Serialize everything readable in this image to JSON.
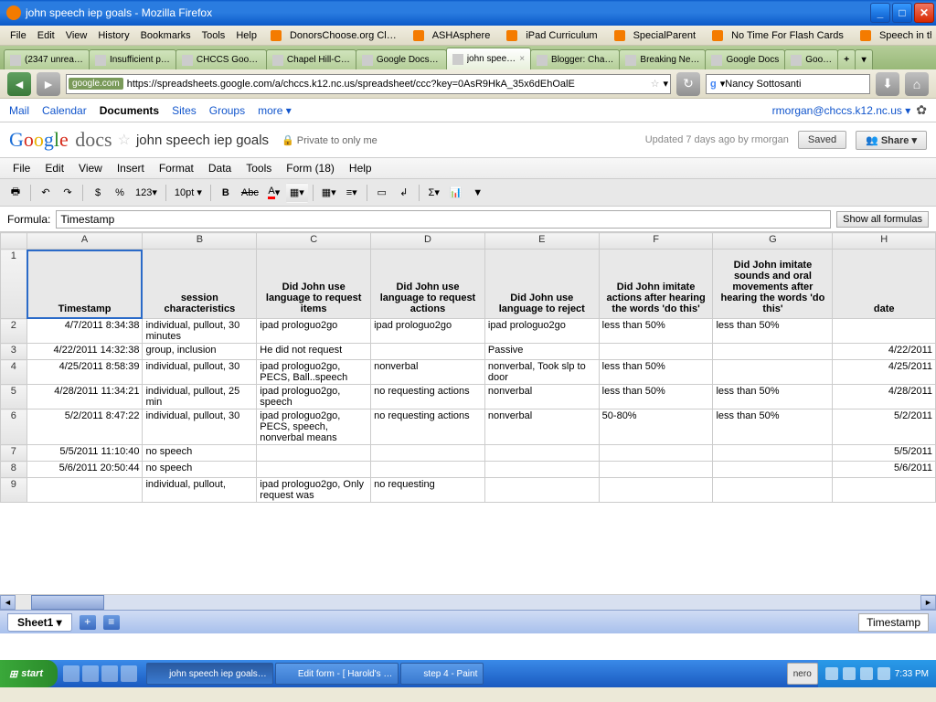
{
  "window": {
    "title": "john speech iep goals - Mozilla Firefox"
  },
  "firefoxMenu": [
    "File",
    "Edit",
    "View",
    "History",
    "Bookmarks",
    "Tools",
    "Help"
  ],
  "bookmarks": [
    "DonorsChoose.org Cl…",
    "ASHAsphere",
    "iPad Curriculum",
    "SpecialParent",
    "No Time For Flash Cards",
    "Speech in the Schools"
  ],
  "browserTabs": [
    {
      "label": "(2347 unrea…"
    },
    {
      "label": "Insufficient p…"
    },
    {
      "label": "CHCCS Googl…"
    },
    {
      "label": "Chapel Hill-C…"
    },
    {
      "label": "Google Docs …"
    },
    {
      "label": "john spee…",
      "active": true
    },
    {
      "label": "Blogger: Cha…"
    },
    {
      "label": "Breaking Ne…"
    },
    {
      "label": "Google Docs"
    },
    {
      "label": "Goo…"
    }
  ],
  "url": {
    "chip": "google.com",
    "path": "https://spreadsheets.google.com/a/chccs.k12.nc.us/spreadsheet/ccc?key=0AsR9HkA_35x6dEhOalE"
  },
  "search": {
    "value": "Nancy Sottosanti"
  },
  "gdocs": {
    "nav": [
      "Mail",
      "Calendar",
      "Documents",
      "Sites",
      "Groups",
      "more ▾"
    ],
    "navActive": "Documents",
    "user": "rmorgan@chccs.k12.nc.us ▾",
    "docName": "john speech iep goals",
    "privacy": "Private to only me",
    "updated": "Updated 7 days ago by rmorgan",
    "saved": "Saved",
    "share": "Share ▾",
    "menu": [
      "File",
      "Edit",
      "View",
      "Insert",
      "Format",
      "Data",
      "Tools",
      "Form (18)",
      "Help"
    ],
    "formula": {
      "label": "Formula:",
      "value": "Timestamp",
      "showAll": "Show all formulas"
    },
    "sheetTab": "Sheet1 ▾",
    "statusCell": "Timestamp"
  },
  "columns": [
    "A",
    "B",
    "C",
    "D",
    "E",
    "F",
    "G",
    "H"
  ],
  "headers": [
    "Timestamp",
    "session characteristics",
    "Did John use language to request items",
    "Did John use language to request actions",
    "Did John use language to reject",
    "Did John imitate actions after hearing the words 'do this'",
    "Did John imitate sounds and oral movements after hearing the words 'do this'",
    "date"
  ],
  "rows": [
    {
      "n": "2",
      "c": [
        "4/7/2011 8:34:38",
        "individual, pullout, 30 minutes",
        "ipad prologuo2go",
        "ipad prologuo2go",
        "ipad prologuo2go",
        "less than 50%",
        "less than 50%",
        ""
      ]
    },
    {
      "n": "3",
      "c": [
        "4/22/2011 14:32:38",
        "group, inclusion",
        "He did not request",
        "",
        "Passive",
        "",
        "",
        "4/22/2011"
      ]
    },
    {
      "n": "4",
      "c": [
        "4/25/2011 8:58:39",
        "individual, pullout, 30",
        "ipad prologuo2go, PECS, Ball..speech",
        "nonverbal",
        "nonverbal, Took slp to door",
        "less than 50%",
        "",
        "4/25/2011"
      ]
    },
    {
      "n": "5",
      "c": [
        "4/28/2011 11:34:21",
        "individual, pullout, 25 min",
        "ipad prologuo2go, speech",
        "no requesting actions",
        "nonverbal",
        "less than 50%",
        "less than 50%",
        "4/28/2011"
      ]
    },
    {
      "n": "6",
      "c": [
        "5/2/2011 8:47:22",
        "individual, pullout, 30",
        "ipad prologuo2go, PECS, speech, nonverbal means",
        "no requesting actions",
        "nonverbal",
        "50-80%",
        "less than 50%",
        "5/2/2011"
      ]
    },
    {
      "n": "7",
      "c": [
        "5/5/2011 11:10:40",
        "no speech",
        "",
        "",
        "",
        "",
        "",
        "5/5/2011"
      ]
    },
    {
      "n": "8",
      "c": [
        "5/6/2011 20:50:44",
        "no speech",
        "",
        "",
        "",
        "",
        "",
        "5/6/2011"
      ]
    },
    {
      "n": "9",
      "c": [
        "",
        "individual, pullout,",
        "ipad prologuo2go, Only request was",
        "no requesting",
        "",
        "",
        "",
        ""
      ]
    }
  ],
  "taskbar": {
    "start": "start",
    "items": [
      "john speech iep goals…",
      "Edit form - [ Harold's …",
      "step 4 - Paint"
    ],
    "nero": "nero",
    "time": "7:33 PM"
  }
}
